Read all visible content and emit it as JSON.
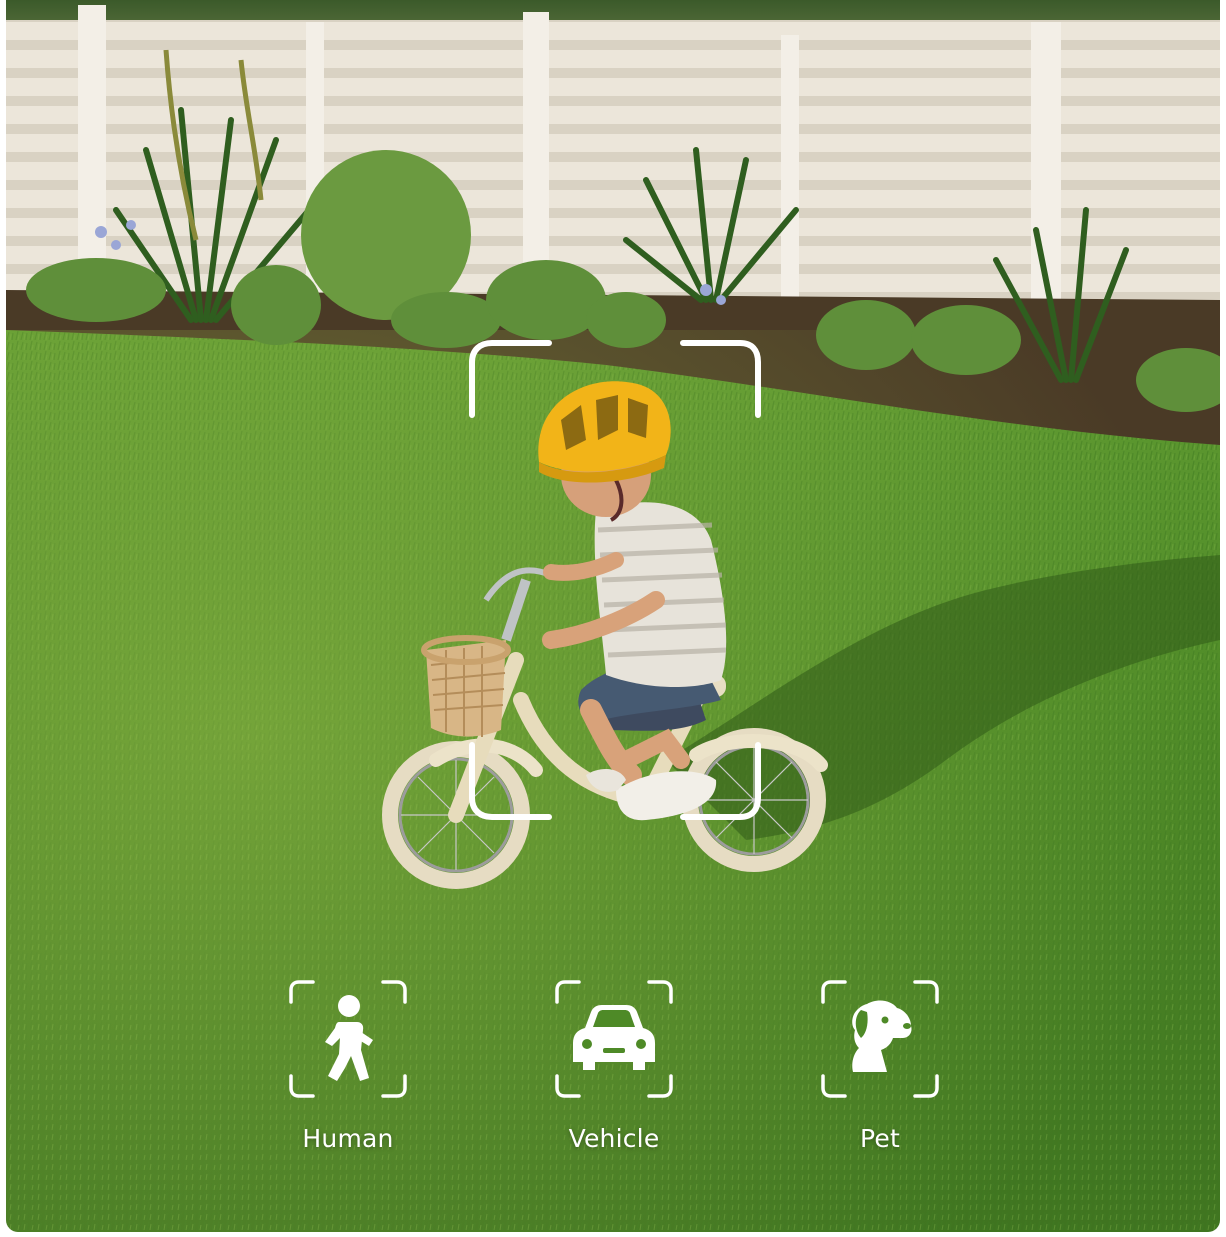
{
  "detection": {
    "items": [
      {
        "label": "Human",
        "icon": "person-walking-icon"
      },
      {
        "label": "Vehicle",
        "icon": "car-icon"
      },
      {
        "label": "Pet",
        "icon": "dog-icon"
      }
    ]
  },
  "colors": {
    "overlay": "#ffffff",
    "grass": "#4f8a2a",
    "fence": "#ece6da",
    "helmet": "#f2b418"
  }
}
